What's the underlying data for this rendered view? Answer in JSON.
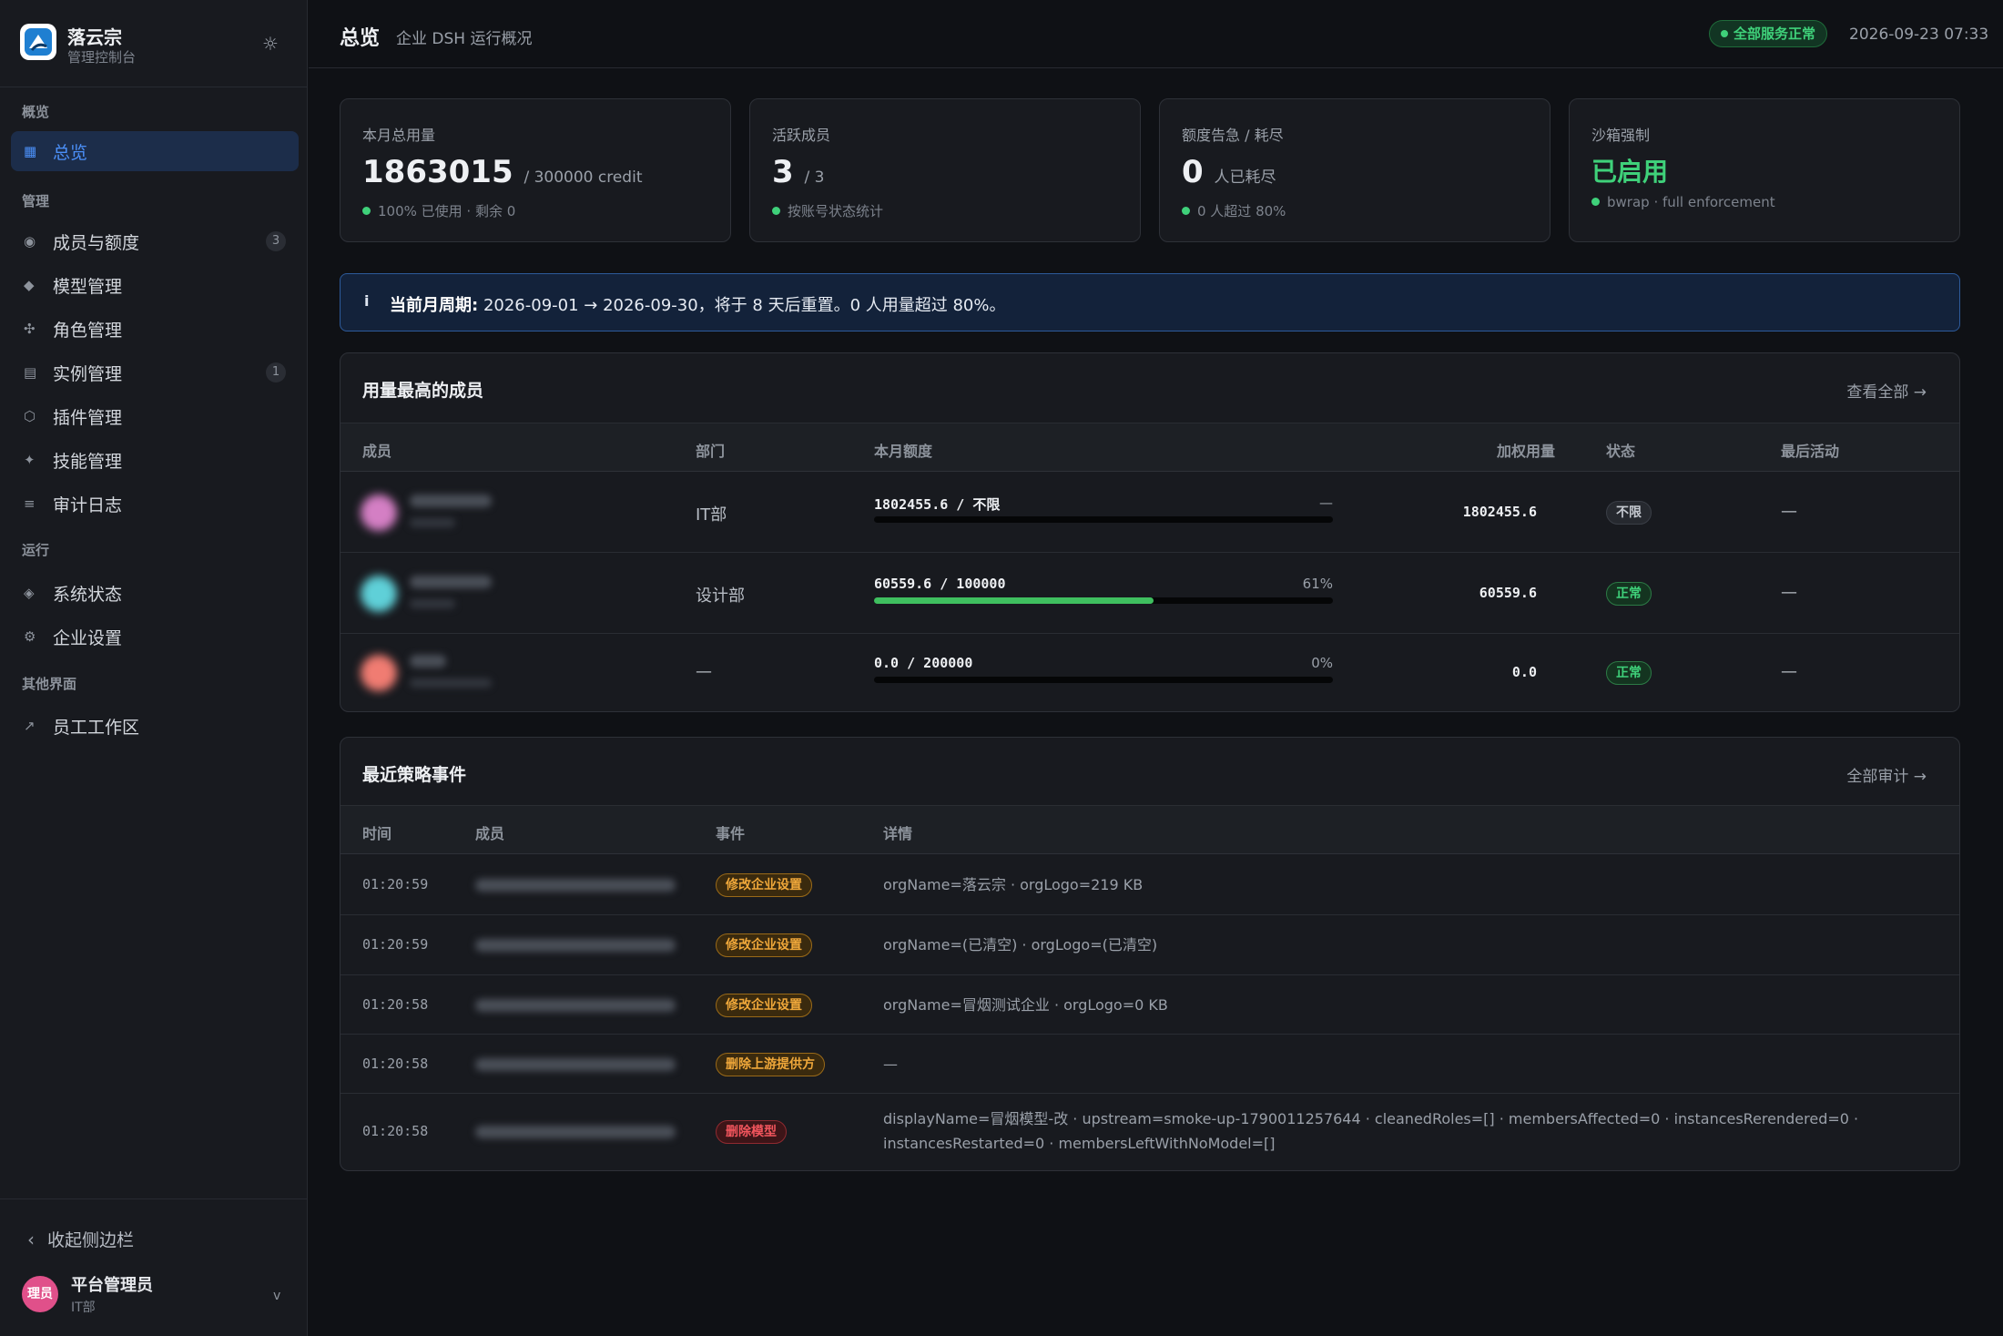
{
  "sidebar": {
    "brand": {
      "name": "落云宗",
      "subtitle": "管理控制台"
    },
    "sections": [
      {
        "title": "概览",
        "items": [
          {
            "label": "总览",
            "icon": "grid-icon",
            "glyph": "▦",
            "active": true
          }
        ]
      },
      {
        "title": "管理",
        "items": [
          {
            "label": "成员与额度",
            "icon": "users-icon",
            "glyph": "◉",
            "count": "3"
          },
          {
            "label": "模型管理",
            "icon": "model-icon",
            "glyph": "◆"
          },
          {
            "label": "角色管理",
            "icon": "roles-icon",
            "glyph": "✣"
          },
          {
            "label": "实例管理",
            "icon": "instances-icon",
            "glyph": "▤",
            "count": "1"
          },
          {
            "label": "插件管理",
            "icon": "plugin-icon",
            "glyph": "⬡"
          },
          {
            "label": "技能管理",
            "icon": "skills-icon",
            "glyph": "✦"
          },
          {
            "label": "审计日志",
            "icon": "audit-icon",
            "glyph": "≡"
          }
        ]
      },
      {
        "title": "运行",
        "items": [
          {
            "label": "系统状态",
            "icon": "status-icon",
            "glyph": "◈"
          },
          {
            "label": "企业设置",
            "icon": "settings-icon",
            "glyph": "⚙"
          }
        ]
      },
      {
        "title": "其他界面",
        "items": [
          {
            "label": "员工工作区",
            "icon": "external-link-icon",
            "glyph": "↗"
          }
        ]
      }
    ],
    "collapse_label": "收起侧边栏",
    "user": {
      "avatar_text": "理员",
      "name": "平台管理员",
      "dept": "IT部"
    }
  },
  "header": {
    "title": "总览",
    "subtitle": "企业 DSH 运行概况",
    "service_badge": "全部服务正常",
    "datetime": "2026-09-23 07:33"
  },
  "stats": [
    {
      "label": "本月总用量",
      "value": "1863015",
      "suffix": "/ 300000 credit",
      "note": "100% 已使用 · 剩余 0"
    },
    {
      "label": "活跃成员",
      "value": "3",
      "suffix": "/ 3",
      "note": "按账号状态统计"
    },
    {
      "label": "额度告急 / 耗尽",
      "value": "0",
      "suffix": "人已耗尽",
      "note": "0 人超过 80%"
    },
    {
      "label": "沙箱强制",
      "value": "已启用",
      "note": "bwrap · full enforcement"
    }
  ],
  "banner": {
    "icon": "info-icon",
    "bold": "当前月周期:",
    "text": "2026-09-01 → 2026-09-30，将于 8 天后重置。0 人用量超过 80%。"
  },
  "top_members": {
    "title": "用量最高的成员",
    "link": "查看全部 →",
    "columns": [
      "成员",
      "部门",
      "本月额度",
      "加权用量",
      "状态",
      "最后活动"
    ],
    "rows": [
      {
        "dept": "IT部",
        "quota": "1802455.6  /  不限",
        "percent_text": "—",
        "fill": 0,
        "weighted": "1802455.6",
        "status": "不限",
        "status_kind": "gray",
        "last": "—",
        "avatar_color": "#d47fc4"
      },
      {
        "dept": "设计部",
        "quota": "60559.6  /  100000",
        "percent_text": "61%",
        "fill": 0.61,
        "weighted": "60559.6",
        "status": "正常",
        "status_kind": "green",
        "last": "—",
        "avatar_color": "#5fd0d8"
      },
      {
        "dept": "—",
        "quota": "0.0  /  200000",
        "percent_text": "0%",
        "fill": 0,
        "weighted": "0.0",
        "status": "正常",
        "status_kind": "green",
        "last": "—",
        "avatar_color": "#f07c72"
      }
    ]
  },
  "events": {
    "title": "最近策略事件",
    "link": "全部审计 →",
    "columns": [
      "时间",
      "成员",
      "事件",
      "详情"
    ],
    "rows": [
      {
        "time": "01:20:59",
        "event": "修改企业设置",
        "kind": "orange",
        "detail": "orgName=落云宗 · orgLogo=219 KB"
      },
      {
        "time": "01:20:59",
        "event": "修改企业设置",
        "kind": "orange",
        "detail": "orgName=(已清空) · orgLogo=(已清空)"
      },
      {
        "time": "01:20:58",
        "event": "修改企业设置",
        "kind": "orange",
        "detail": "orgName=冒烟测试企业 · orgLogo=0 KB"
      },
      {
        "time": "01:20:58",
        "event": "删除上游提供方",
        "kind": "orange",
        "detail": "—"
      },
      {
        "time": "01:20:58",
        "event": "删除模型",
        "kind": "red",
        "detail": "displayName=冒烟模型-改 · upstream=smoke-up-1790011257644 · cleanedRoles=[] · membersAffected=0 · instancesRerendered=0 · instancesRestarted=0 · membersLeftWithNoModel=[]"
      }
    ]
  },
  "colors": {
    "accent": "#4b8ff7",
    "success": "#3fd17a",
    "warning": "#f0a83a",
    "danger": "#f2555d"
  }
}
